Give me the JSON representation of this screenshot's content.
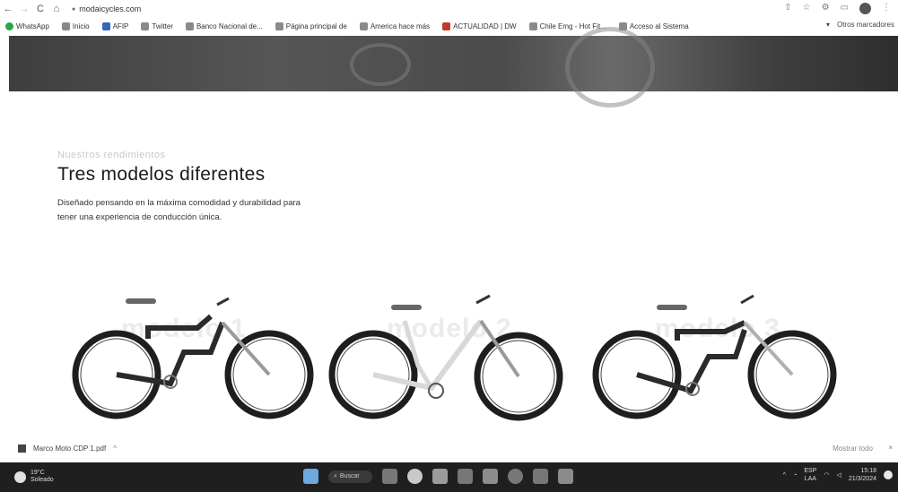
{
  "browser": {
    "url": "modaicycles.com",
    "nav": {
      "back": "←",
      "forward": "→",
      "reload": "C",
      "home": "⌂"
    },
    "bookmarks": [
      {
        "label": "WhatsApp",
        "color": "#2aa34a"
      },
      {
        "label": "Inicio",
        "color": "#8a8a8a"
      },
      {
        "label": "AFIP",
        "color": "#3366bb"
      },
      {
        "label": "Twitter",
        "color": "#8a8a8a"
      },
      {
        "label": "Banco Nacional de...",
        "color": "#8a8a8a"
      },
      {
        "label": "Página principal de",
        "color": "#8a8a8a"
      },
      {
        "label": "America hace más",
        "color": "#8a8a8a"
      },
      {
        "label": "ACTUALIDAD | DW",
        "color": "#c0392b"
      },
      {
        "label": "Chile Emg - Hot Fit...",
        "color": "#8a8a8a"
      },
      {
        "label": "Acceso al Sistema",
        "color": "#8a8a8a"
      }
    ],
    "other_bookmarks": "Otros marcadores"
  },
  "page": {
    "eyebrow": "Nuestros rendimientos",
    "headline": "Tres modelos diferentes",
    "description": "Diseñado pensando en la máxima comodidad y durabilidad para tener una experiencia de conducción única.",
    "bikes": [
      {
        "watermark": "modelo 1",
        "frame_color": "#2a2a2a",
        "accent_color": "#9a9a9a"
      },
      {
        "watermark": "modelo 2",
        "frame_color": "#e4e4e4",
        "accent_color": "#9a9a9a"
      },
      {
        "watermark": "modelo 3",
        "frame_color": "#2a2a2a",
        "accent_color": "#b0b0b0"
      }
    ]
  },
  "download_bar": {
    "file_name": "Marco Moto CDP 1.pdf",
    "show_all": "Mostrar todo",
    "close": "×"
  },
  "taskbar": {
    "weather_temp": "19°C",
    "weather_desc": "Soleado",
    "search_label": "Buscar",
    "lang_line1": "ESP",
    "lang_line2": "LAA",
    "time": "15:18",
    "date": "21/3/2024"
  }
}
